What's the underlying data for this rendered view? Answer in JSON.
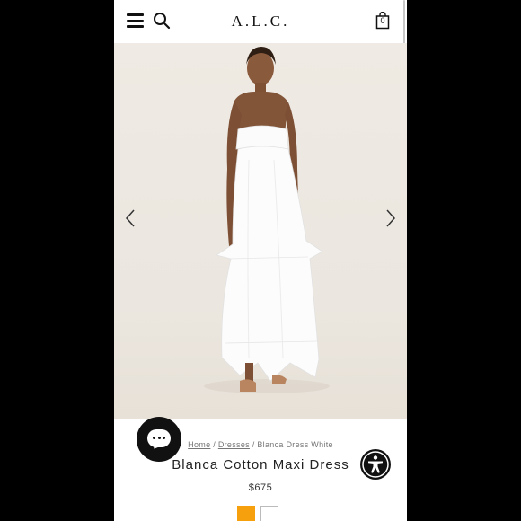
{
  "header": {
    "brand": "A.L.C.",
    "bag_count": "0",
    "icons": [
      "hamburger-menu-icon",
      "search-icon",
      "shopping-bag-icon"
    ]
  },
  "gallery": {
    "image_alt": "Model wearing white strapless maxi dress",
    "prev_icon": "chevron-left-icon",
    "next_icon": "chevron-right-icon"
  },
  "breadcrumb": {
    "home": "Home",
    "sep1": "/",
    "category": "Dresses",
    "sep2": "/",
    "current": "Blanca Dress White"
  },
  "product": {
    "title": "Blanca Cotton Maxi Dress",
    "price": "$675",
    "swatches": [
      {
        "name": "orange",
        "color": "#f5a00c"
      },
      {
        "name": "white",
        "color": "#ffffff"
      }
    ]
  },
  "floating": {
    "chat_icon": "chat-bubble-icon",
    "accessibility_icon": "accessibility-icon"
  },
  "colors": {
    "page_background": "#000000",
    "text": "#222222",
    "accent_swatch": "#f5a00c"
  }
}
